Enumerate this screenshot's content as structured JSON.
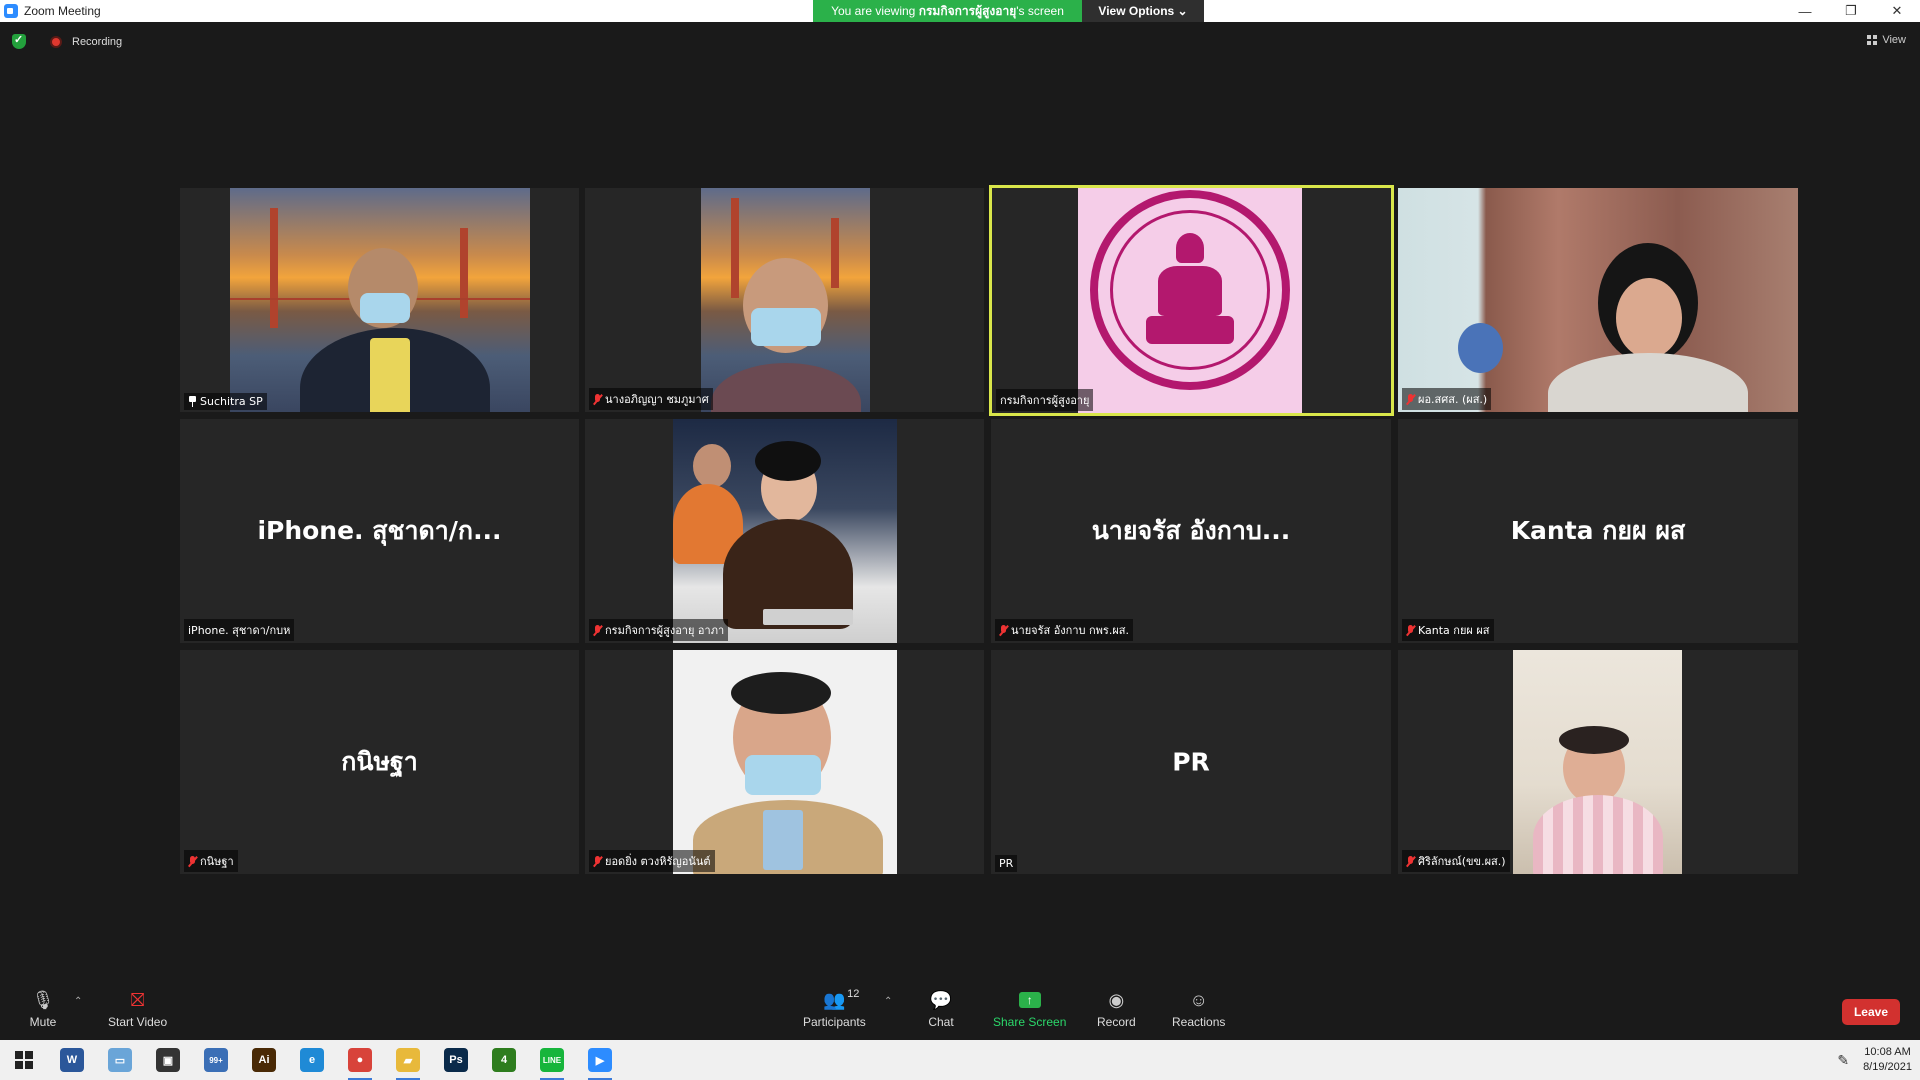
{
  "window": {
    "title": "Zoom Meeting",
    "minimize": "—",
    "restore": "❐",
    "close": "✕"
  },
  "banner": {
    "viewing_prefix": "You are viewing ",
    "viewing_name": "กรมกิจการผู้สูงอายุ",
    "viewing_suffix": "'s screen",
    "view_options": "View Options ⌄"
  },
  "status": {
    "recording": "Recording",
    "view": "View"
  },
  "participants": [
    {
      "big_name": "",
      "label": "Suchitra SP",
      "icon": "pin-icon"
    },
    {
      "big_name": "",
      "label": "นางอภิญญา ชมภูมาศ",
      "icon": "mic-off-icon"
    },
    {
      "big_name": "",
      "label": "กรมกิจการผู้สูงอายุ",
      "icon": ""
    },
    {
      "big_name": "",
      "label": "ผอ.สศส. (ผส.)",
      "icon": "mic-off-icon"
    },
    {
      "big_name": "iPhone. สุชาดา/ก...",
      "label": "iPhone. สุชาดา/กบห",
      "icon": ""
    },
    {
      "big_name": "",
      "label": "กรมกิจการผู้สูงอายุ อาภา",
      "icon": "mic-off-icon"
    },
    {
      "big_name": "นายจรัส  อังกาบ...",
      "label": "นายจรัส  อังกาบ  กพร.ผส.",
      "icon": "mic-off-icon"
    },
    {
      "big_name": "Kanta กยผ ผส",
      "label": "Kanta กยผ ผส",
      "icon": "mic-off-icon"
    },
    {
      "big_name": "กนิษฐา",
      "label": "กนิษฐา",
      "icon": "mic-off-icon"
    },
    {
      "big_name": "",
      "label": "ยอดยิ่ง ตวงหิรัญอนันต์",
      "icon": "mic-off-icon"
    },
    {
      "big_name": "PR",
      "label": "PR",
      "icon": ""
    },
    {
      "big_name": "",
      "label": "ศิริลักษณ์(ขข.ผส.)",
      "icon": "mic-off-icon"
    }
  ],
  "toolbar": {
    "mute": "Mute",
    "start_video": "Start Video",
    "participants": "Participants",
    "participants_count": "12",
    "chat": "Chat",
    "share_screen": "Share Screen",
    "record": "Record",
    "reactions": "Reactions",
    "leave": "Leave"
  },
  "taskbar": {
    "apps": [
      {
        "name": "word-icon",
        "glyph": "W",
        "color": "#2b579a"
      },
      {
        "name": "laptop-icon",
        "glyph": "▭",
        "color": "#6aa5d8"
      },
      {
        "name": "store-icon",
        "glyph": "▣",
        "color": "#333333"
      },
      {
        "name": "mail-icon",
        "glyph": "99+",
        "color": "#3b6fb6"
      },
      {
        "name": "illustrator-icon",
        "glyph": "Ai",
        "color": "#4a2a06"
      },
      {
        "name": "edge-icon",
        "glyph": "e",
        "color": "#1f8ad6"
      },
      {
        "name": "chrome-icon",
        "glyph": "●",
        "color": "#d8433a"
      },
      {
        "name": "folder-icon",
        "glyph": "▰",
        "color": "#e8b93b"
      },
      {
        "name": "photoshop-icon",
        "glyph": "Ps",
        "color": "#0a2a4a"
      },
      {
        "name": "app4-icon",
        "glyph": "4",
        "color": "#2e7d1e"
      },
      {
        "name": "line-icon",
        "glyph": "LINE",
        "color": "#17b53c"
      },
      {
        "name": "zoom-icon",
        "glyph": "▶",
        "color": "#2d8cff"
      }
    ],
    "time": "10:08 AM",
    "date": "8/19/2021"
  }
}
